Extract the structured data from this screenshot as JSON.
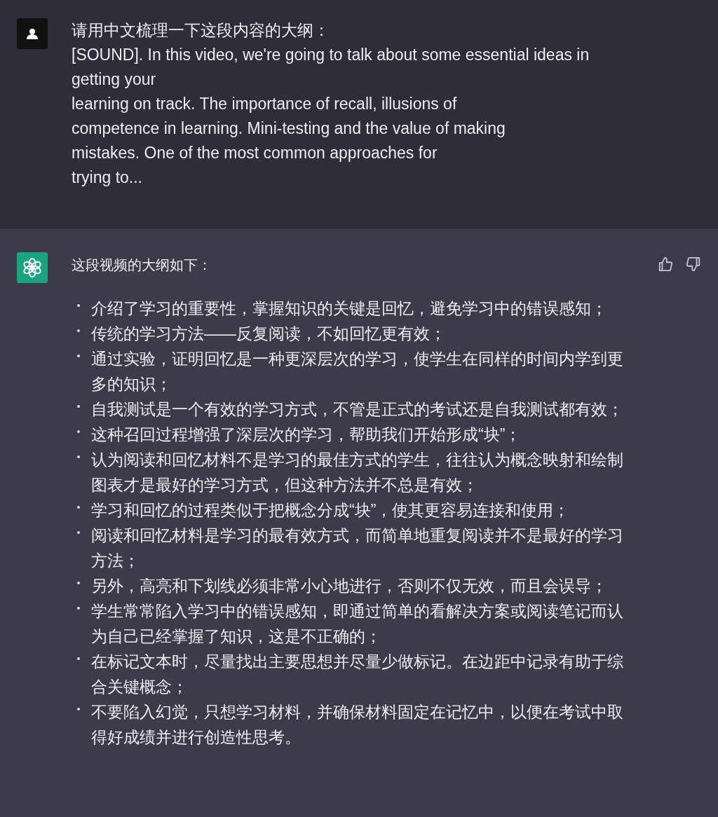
{
  "messages": [
    {
      "kind": "user",
      "lines": [
        "请用中文梳理一下这段内容的大纲：",
        "[SOUND]. In this video, we're going to talk about some essential ideas in",
        "getting your",
        "learning on track. The importance of recall, illusions of",
        "competence in learning. Mini-testing and the value of making",
        "mistakes. One of the most common approaches for",
        "trying to..."
      ]
    },
    {
      "kind": "assistant",
      "intro": "这段视频的大纲如下：",
      "bullets": [
        "介绍了学习的重要性，掌握知识的关键是回忆，避免学习中的错误感知；",
        "传统的学习方法——反复阅读，不如回忆更有效；",
        "通过实验，证明回忆是一种更深层次的学习，使学生在同样的时间内学到更多的知识；",
        "自我测试是一个有效的学习方式，不管是正式的考试还是自我测试都有效；",
        "这种召回过程增强了深层次的学习，帮助我们开始形成“块”；",
        "认为阅读和回忆材料不是学习的最佳方式的学生，往往认为概念映射和绘制图表才是最好的学习方式，但这种方法并不总是有效；",
        "学习和回忆的过程类似于把概念分成“块”，使其更容易连接和使用；",
        "阅读和回忆材料是学习的最有效方式，而简单地重复阅读并不是最好的学习方法；",
        "另外，高亮和下划线必须非常小心地进行，否则不仅无效，而且会误导；",
        "学生常常陷入学习中的错误感知，即通过简单的看解决方案或阅读笔记而认为自己已经掌握了知识，这是不正确的；",
        "在标记文本时，尽量找出主要思想并尽量少做标记。在边距中记录有助于综合关键概念；",
        "不要陷入幻觉，只想学习材料，并确保材料固定在记忆中，以便在考试中取得好成绩并进行创造性思考。"
      ]
    }
  ]
}
